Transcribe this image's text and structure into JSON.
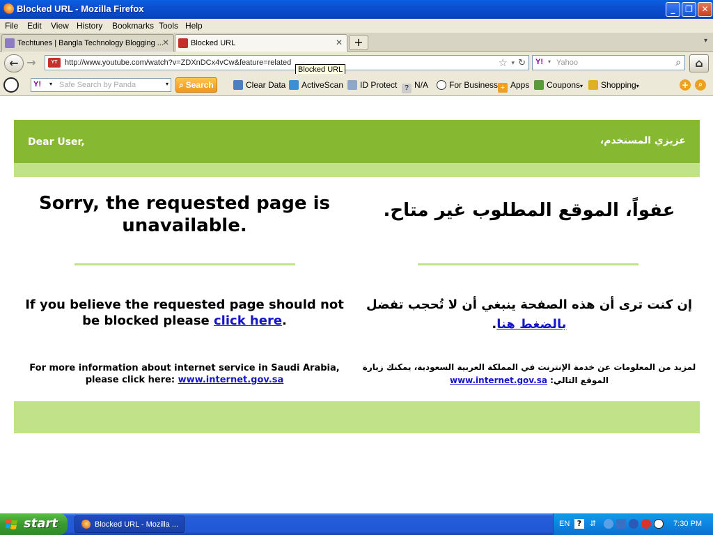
{
  "window": {
    "title": "Blocked URL - Mozilla Firefox"
  },
  "menu": {
    "items": [
      "File",
      "Edit",
      "View",
      "History",
      "Bookmarks",
      "Tools",
      "Help"
    ]
  },
  "tabs": [
    {
      "label": "Techtunes | Bangla Technology Blogging ...",
      "active": false
    },
    {
      "label": "Blocked URL",
      "active": true
    }
  ],
  "new_tab_symbol": "+",
  "navbar": {
    "url": "http://www.youtube.com/watch?v=ZDXnDCx4vCw&feature=related",
    "favicon_text": "You Tube",
    "search_placeholder": "Yahoo",
    "tooltip": "Blocked URL"
  },
  "panda_toolbar": {
    "search_placeholder": "Safe Search by Panda",
    "search_button": "Search",
    "clear_data": "Clear Data",
    "activescan": "ActiveScan",
    "id_protect": "ID Protect",
    "na": "N/A",
    "for_business": "For Business",
    "apps": "Apps",
    "coupons": "Coupons",
    "shopping": "Shopping"
  },
  "page": {
    "greeting_en": "Dear User,",
    "greeting_ar": "عزيزي المستخدم،",
    "headline_en": "Sorry, the requested page is unavailable.",
    "headline_ar": "عفواً، الموقع المطلوب غير متاح.",
    "para_en_prefix": "If you believe the requested page should not be blocked please ",
    "para_en_link": "click here",
    "para_en_suffix": ".",
    "para_ar_prefix": "إن كنت ترى أن هذه الصفحة ينبغي أن لا تُحجب تفضل ",
    "para_ar_link": "بالضغط هنا",
    "para_ar_suffix": ".",
    "info_en_prefix": "For more information about internet service in Saudi Arabia, please click here: ",
    "info_en_link": "www.internet.gov.sa",
    "info_ar_prefix": "لمزيد من المعلومات عن خدمة الإنترنت في المملكة العربية السعودية، يمكنك زيارة الموقع التالي: ",
    "info_ar_link": "www.internet.gov.sa",
    "colors": {
      "banner": "#86b831",
      "light_band": "#c2e28a",
      "link": "#1515c9"
    }
  },
  "taskbar": {
    "start_label": "start",
    "task_item": "Blocked URL - Mozilla ...",
    "lang": "EN",
    "clock": "7:30 PM"
  }
}
